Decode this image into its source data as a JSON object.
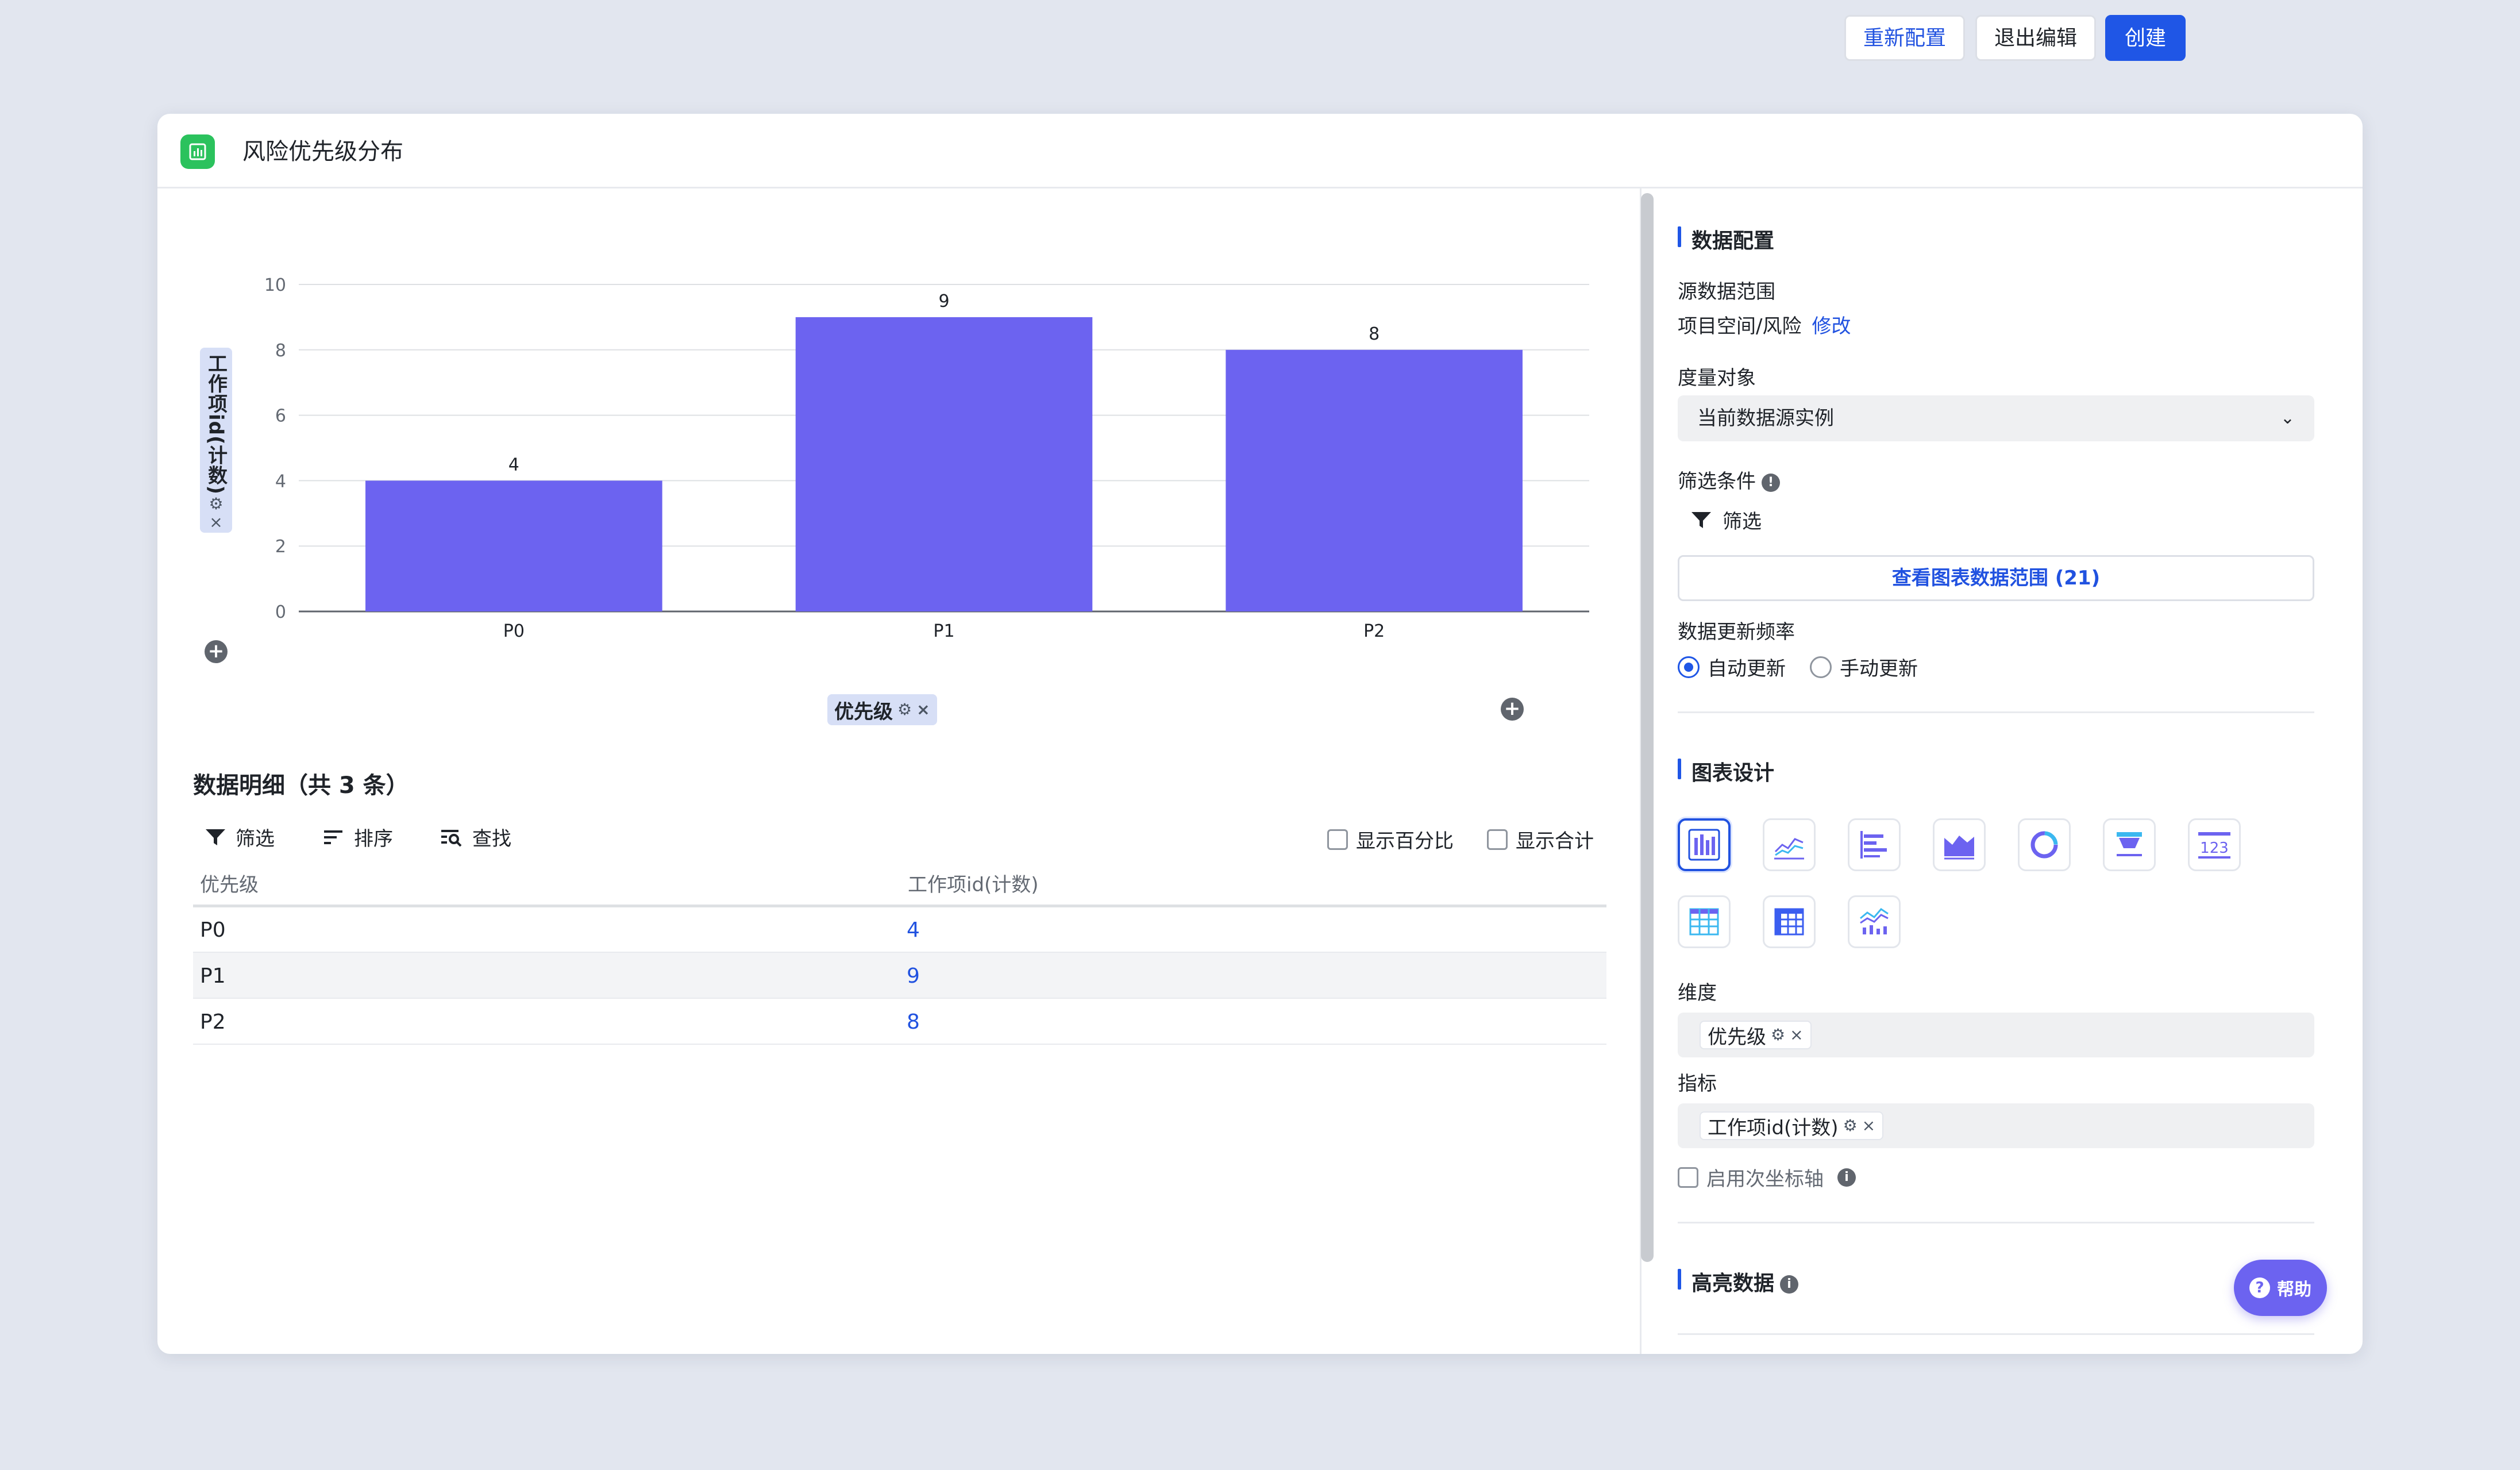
{
  "header": {
    "title": "风险优先级分布",
    "reconfigure_label": "重新配置",
    "exit_edit_label": "退出编辑",
    "create_label": "创建"
  },
  "chart_data": {
    "type": "bar",
    "categories": [
      "P0",
      "P1",
      "P2"
    ],
    "values": [
      4,
      9,
      8
    ],
    "xlabel": "优先级",
    "ylabel": "工作项id(计数)",
    "ylim": [
      0,
      10
    ],
    "yticks": [
      0,
      2,
      4,
      6,
      8,
      10
    ],
    "bar_color": "#6c63f0",
    "grid": true
  },
  "details": {
    "title": "数据明细（共 3 条）",
    "toolbar": {
      "filter": "筛选",
      "sort": "排序",
      "find": "查找"
    },
    "show_percent": "显示百分比",
    "show_total": "显示合计",
    "columns": [
      "优先级",
      "工作项id(计数)"
    ],
    "rows": [
      {
        "key": "P0",
        "value": "4"
      },
      {
        "key": "P1",
        "value": "9"
      },
      {
        "key": "P2",
        "value": "8"
      }
    ]
  },
  "config": {
    "data_section_title": "数据配置",
    "source_range_label": "源数据范围",
    "source_range_value": "项目空间/风险",
    "modify_link": "修改",
    "measure_object_label": "度量对象",
    "measure_object_value": "当前数据源实例",
    "filter_condition_label": "筛选条件",
    "filter_label": "筛选",
    "view_range_button": "查看图表数据范围 (21)",
    "update_freq_label": "数据更新频率",
    "auto_update": "自动更新",
    "manual_update": "手动更新",
    "design_section_title": "图表设计",
    "chart_type_icons": [
      "bar-chart-icon",
      "line-chart-icon",
      "horizontal-bar-icon",
      "area-chart-icon",
      "donut-chart-icon",
      "funnel-chart-icon",
      "number-card-icon",
      "table-icon",
      "pivot-table-icon",
      "combo-chart-icon"
    ],
    "dimension_label": "维度",
    "dimension_chip": "优先级",
    "metric_label": "指标",
    "metric_chip": "工作项id(计数)",
    "secondary_axis_label": "启用次坐标轴",
    "highlight_section_title": "高亮数据",
    "help_label": "帮助"
  },
  "colors": {
    "accent": "#1f56e6",
    "bar": "#6c63f0",
    "app_icon": "#2bc25d",
    "background": "#e2e6ef"
  }
}
